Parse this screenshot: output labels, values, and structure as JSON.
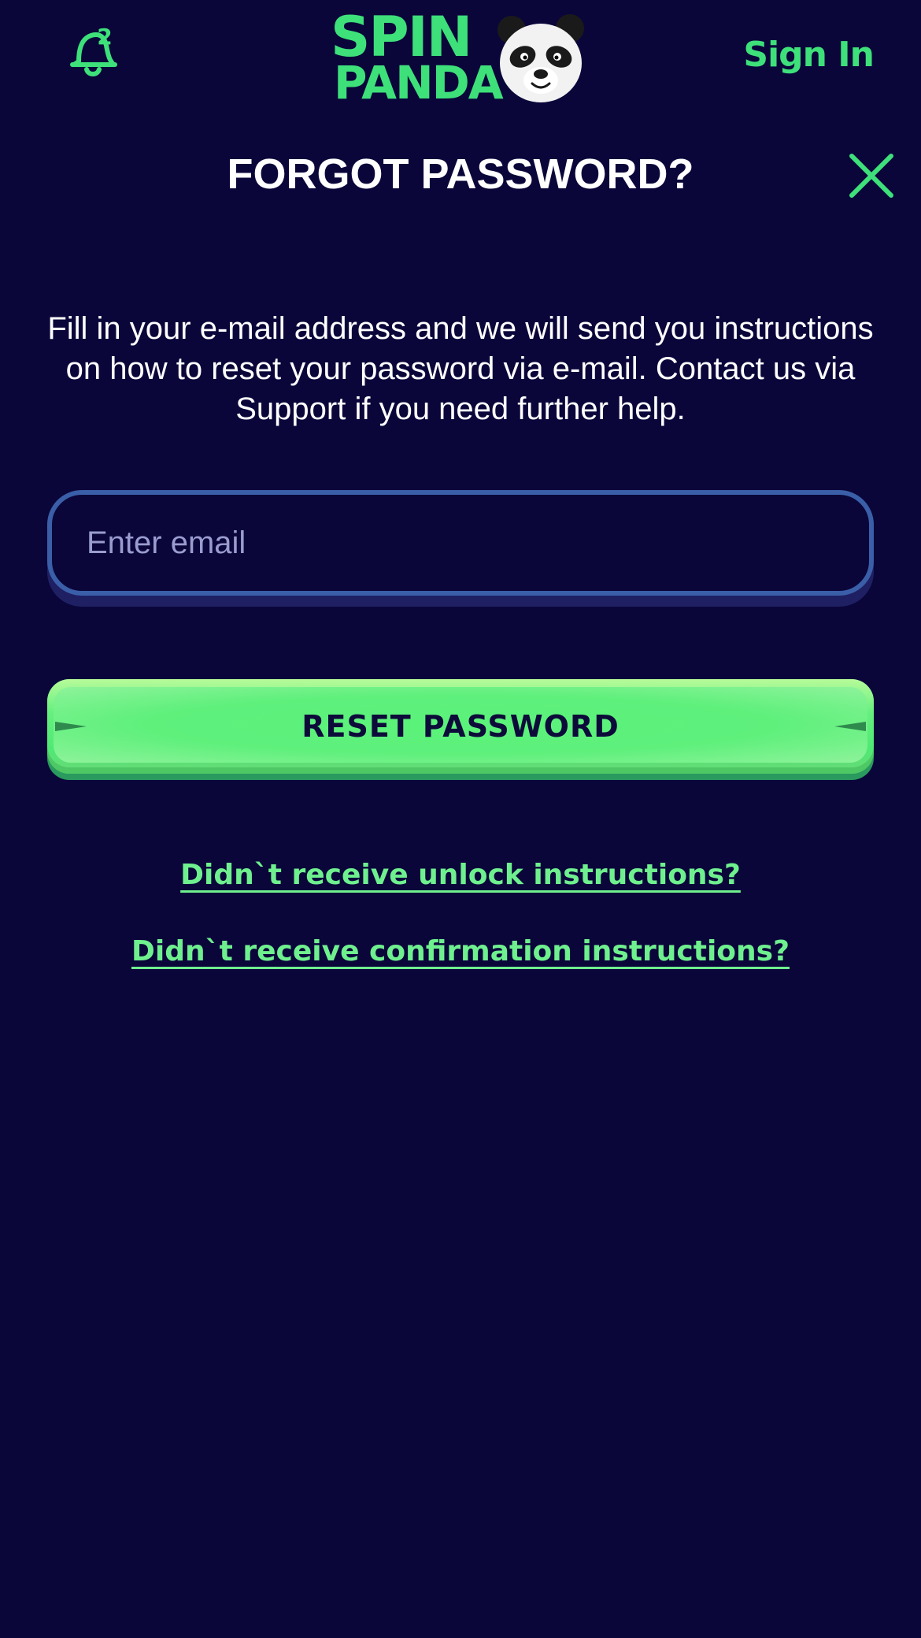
{
  "header": {
    "notification_count": "2",
    "logo": {
      "line1": "SPIN",
      "line2": "PANDA"
    },
    "sign_in_label": "Sign In"
  },
  "page": {
    "title": "FORGOT PASSWORD?",
    "description": "Fill in your e-mail address and we will send you instructions on how to reset your password via e-mail. Contact us via Support if you need further help."
  },
  "form": {
    "email": {
      "value": "",
      "placeholder": "Enter email"
    },
    "submit_label": "RESET PASSWORD"
  },
  "links": {
    "unlock": "Didn`t receive unlock instructions?",
    "confirmation": "Didn`t receive confirmation instructions?"
  },
  "colors": {
    "background": "#0a063a",
    "accent_green": "#3ee07a",
    "link_green": "#6ff08e",
    "input_border": "#3a5fa8"
  },
  "icons": {
    "notification": "bell-icon",
    "close": "close-icon",
    "mascot": "panda-icon"
  }
}
